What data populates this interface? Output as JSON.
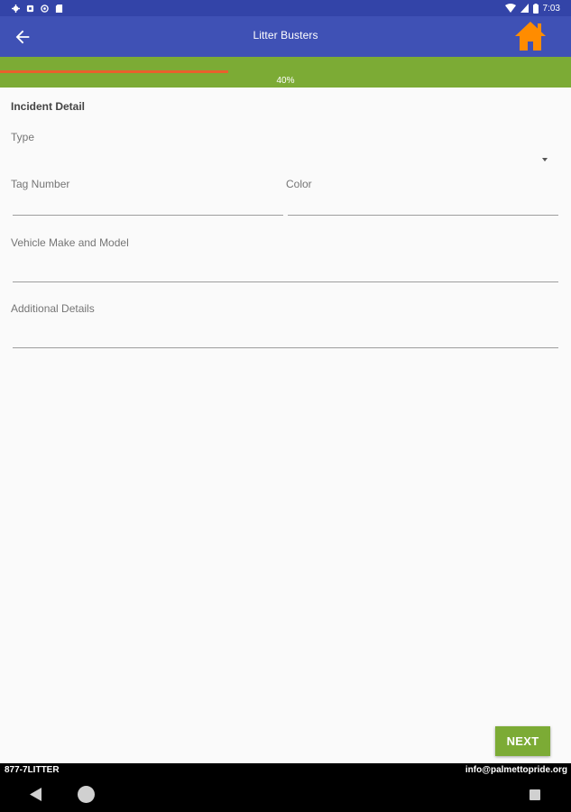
{
  "status_bar": {
    "time": "7:03",
    "left_icons": [
      "settings-icon",
      "sim-icon",
      "circle-icon",
      "sd-card-icon"
    ],
    "right_icons": [
      "wifi-icon",
      "signal-icon",
      "battery-icon"
    ]
  },
  "app_bar": {
    "title": "Litter Busters",
    "back_icon": "arrow-left-icon",
    "home_icon": "home-icon",
    "home_color": "#ff8c00",
    "background": "#3f51b5"
  },
  "progress": {
    "label": "40%",
    "value": 0.4,
    "track_color": "#7cab35",
    "fill_color": "#e8602c"
  },
  "form": {
    "section_title": "Incident Detail",
    "type_label": "Type",
    "type_value": "",
    "tag_label": "Tag Number",
    "tag_value": "",
    "color_label": "Color",
    "color_value": "",
    "vehicle_label": "Vehicle Make and Model",
    "vehicle_value": "",
    "details_label": "Additional Details",
    "details_value": ""
  },
  "next_button": {
    "label": "NEXT"
  },
  "footer": {
    "phone": "877-7LITTER",
    "email": "info@palmettopride.org"
  },
  "nav_bar": {
    "icons": [
      "nav-back-icon",
      "nav-home-icon",
      "nav-recents-icon"
    ]
  }
}
